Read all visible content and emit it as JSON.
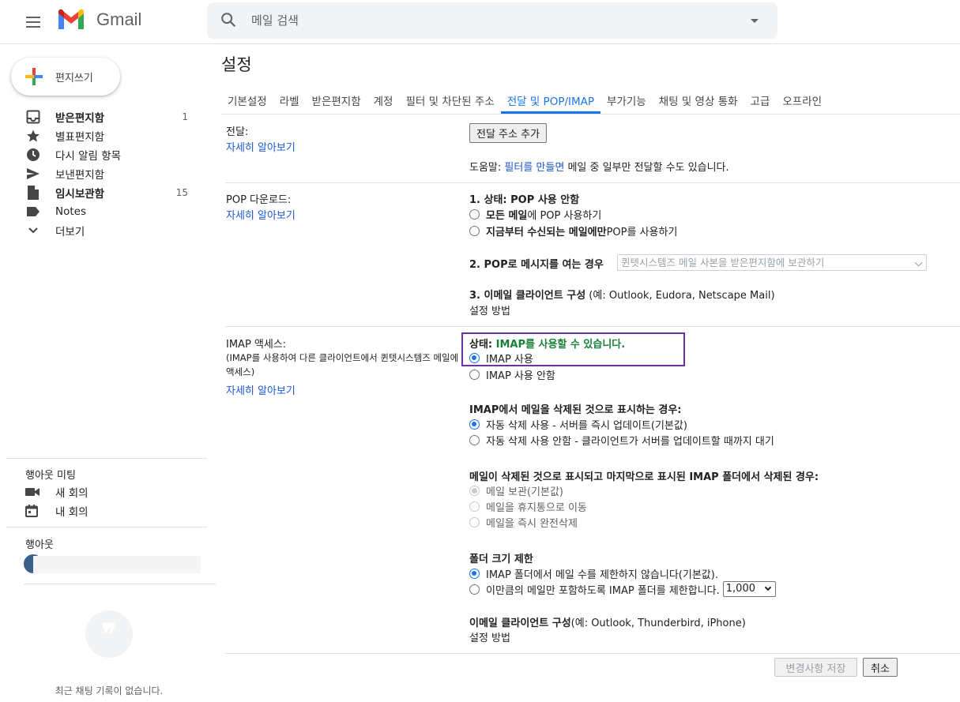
{
  "header": {
    "app_name": "Gmail",
    "search_placeholder": "메일 검색",
    "icons": [
      "menu-icon",
      "gmail-logo",
      "search-icon",
      "search-options-icon"
    ]
  },
  "sidebar": {
    "compose_label": "편지쓰기",
    "items": [
      {
        "label": "받은편지함",
        "count": "1",
        "bold": true,
        "icon": "inbox-icon"
      },
      {
        "label": "별표편지함",
        "count": "",
        "bold": false,
        "icon": "star-icon"
      },
      {
        "label": "다시 알림 항목",
        "count": "",
        "bold": false,
        "icon": "clock-icon"
      },
      {
        "label": "보낸편지함",
        "count": "",
        "bold": false,
        "icon": "send-icon"
      },
      {
        "label": "임시보관함",
        "count": "15",
        "bold": true,
        "icon": "draft-icon"
      },
      {
        "label": "Notes",
        "count": "",
        "bold": false,
        "icon": "label-icon"
      },
      {
        "label": "더보기",
        "count": "",
        "bold": false,
        "icon": "chevron-down-icon"
      }
    ],
    "meet": {
      "title": "행아웃 미팅",
      "new_meeting": "새 회의",
      "my_meetings": "내 회의"
    },
    "hangouts": {
      "title": "행아웃",
      "empty_text": "최근 채팅 기록이 없습니다."
    }
  },
  "main": {
    "title": "설정",
    "tabs": [
      {
        "label": "기본설정",
        "active": false
      },
      {
        "label": "라벨",
        "active": false
      },
      {
        "label": "받은편지함",
        "active": false
      },
      {
        "label": "계정",
        "active": false
      },
      {
        "label": "필터 및 차단된 주소",
        "active": false
      },
      {
        "label": "전달 및 POP/IMAP",
        "active": true
      },
      {
        "label": "부가기능",
        "active": false
      },
      {
        "label": "채팅 및 영상 통화",
        "active": false
      },
      {
        "label": "고급",
        "active": false
      },
      {
        "label": "오프라인",
        "active": false
      }
    ],
    "forwarding": {
      "label": "전달:",
      "learn_more": "자세히 알아보기",
      "add_button": "전달 주소 추가",
      "tip_prefix": "도움말: ",
      "tip_link": "필터를 만들면",
      "tip_suffix": " 메일 중 일부만 전달할 수도 있습니다."
    },
    "pop": {
      "label": "POP 다운로드:",
      "learn_more": "자세히 알아보기",
      "status": "1. 상태: POP 사용 안함",
      "option_all_bold": "모든 메일",
      "option_all_rest": "에 POP 사용하기",
      "option_new_bold": "지금부터 수신되는 메일에만",
      "option_new_rest": " POP를 사용하기",
      "when_open_label": "2. POP로 메시지를 여는 경우",
      "when_open_value": "퀸텟시스템즈 메일 사본을 받은편지함에 보관하기",
      "client_config_bold": "3. 이메일 클라이언트 구성",
      "client_config_rest": " (예: Outlook, Eudora, Netscape Mail)",
      "setup_link": "설정 방법"
    },
    "imap": {
      "label": "IMAP 액세스:",
      "description": "(IMAP를 사용하여 다른 클라이언트에서 퀸텟시스템즈 메일에 액세스)",
      "learn_more": "자세히 알아보기",
      "status_prefix": "상태: ",
      "status_value": "IMAP를 사용할 수 있습니다.",
      "enable": "IMAP 사용",
      "disable": "IMAP 사용 안함",
      "delete_heading": "IMAP에서 메일을 삭제된 것으로 표시하는 경우:",
      "auto_expunge_on": "자동 삭제 사용 - 서버를 즉시 업데이트(기본값)",
      "auto_expunge_off": "자동 삭제 사용 안함 - 클라이언트가 서버를 업데이트할 때까지 대기",
      "expunged_heading": "메일이 삭제된 것으로 표시되고 마지막으로 표시된 IMAP 폴더에서 삭제된 경우:",
      "archive": "메일 보관(기본값)",
      "trash": "메일을 휴지통으로 이동",
      "delete_forever": "메일을 즉시 완전삭제",
      "folder_limit_heading": "폴더 크기 제한",
      "no_limit": "IMAP 폴더에서 메일 수를 제한하지 않습니다(기본값).",
      "limit": "이만큼의 메일만 포함하도록 IMAP 폴더를 제한합니다.",
      "limit_value": "1,000",
      "client_config_bold": "이메일 클라이언트 구성",
      "client_config_rest": "(예: Outlook, Thunderbird, iPhone)",
      "setup_link": "설정 방법"
    },
    "save_button": "변경사항 저장",
    "cancel_button": "취소"
  },
  "colors": {
    "accent": "#1a73e8",
    "link": "#1a57d6",
    "status_green": "#188038",
    "highlight": "#6a329f"
  }
}
